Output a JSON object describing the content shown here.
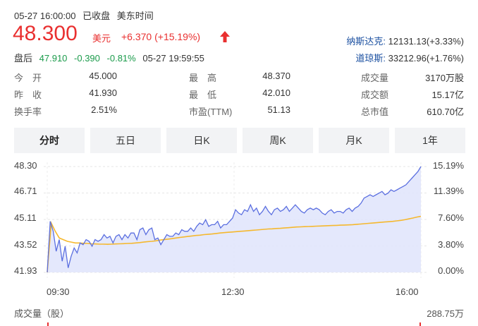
{
  "header": {
    "timestamp": "05-27 16:00:00",
    "market_status": "已收盘",
    "timezone": "美东时间"
  },
  "quote": {
    "price": "48.300",
    "currency": "美元",
    "change": "+6.370 (+15.19%)"
  },
  "after_hours": {
    "label": "盘后",
    "price": "47.910",
    "change": "-0.390",
    "pct": "-0.81%",
    "time": "05-27 19:59:55"
  },
  "indices": [
    {
      "name": "纳斯达克:",
      "value": "12131.13(+3.33%)"
    },
    {
      "name": "道琼斯:",
      "value": "33212.96(+1.76%)"
    }
  ],
  "stats": [
    [
      {
        "label": "今　开",
        "value": "45.000",
        "color": "red"
      },
      {
        "label": "最　高",
        "value": "48.370",
        "color": "red"
      },
      {
        "label": "成交量",
        "value": "3170万股",
        "color": "dark"
      }
    ],
    [
      {
        "label": "昨　收",
        "value": "41.930",
        "color": "dark"
      },
      {
        "label": "最　低",
        "value": "42.010",
        "color": "red"
      },
      {
        "label": "成交额",
        "value": "15.17亿",
        "color": "dark"
      }
    ],
    [
      {
        "label": "换手率",
        "value": "2.51%",
        "color": "dark"
      },
      {
        "label": "市盈(TTM)",
        "value": "51.13",
        "color": "dark"
      },
      {
        "label": "总市值",
        "value": "610.70亿",
        "color": "dark"
      }
    ]
  ],
  "tabs": [
    "分时",
    "五日",
    "日K",
    "周K",
    "月K",
    "1年"
  ],
  "active_tab": "分时",
  "colors": {
    "up": "#e93030",
    "down": "#1b9b4b",
    "price_line": "#5b6fe0",
    "avg_line": "#f5b82e",
    "fill": "#dfe4fb"
  },
  "chart_data": {
    "type": "line",
    "y_labels": [
      "48.30",
      "46.71",
      "45.11",
      "43.52",
      "41.93"
    ],
    "pct_labels": [
      "15.19%",
      "11.39%",
      "7.60%",
      "3.80%",
      "0.00%"
    ],
    "x_labels": [
      "09:30",
      "12:30",
      "16:00"
    ],
    "ylim": [
      41.93,
      48.3
    ],
    "series": [
      {
        "values": [
          41.93,
          45.0,
          44.4,
          43.2,
          43.9,
          42.6,
          43.5,
          42.2,
          42.9,
          43.4,
          43.1,
          43.7,
          43.6,
          43.9,
          43.8,
          43.5,
          43.9,
          43.8,
          43.9,
          44.2,
          44.0,
          44.1,
          43.7,
          44.1,
          44.2,
          43.9,
          44.2,
          44.0,
          44.3,
          44.3,
          43.9,
          44.5,
          44.6,
          44.2,
          44.5,
          44.6,
          43.9,
          44.0,
          43.6,
          43.9,
          44.2,
          44.1,
          44.1,
          44.3,
          44.2,
          44.5,
          44.4,
          44.4,
          44.6,
          44.4,
          44.7,
          44.9,
          44.8,
          45.1,
          44.7,
          44.8,
          44.8,
          45.0,
          44.6,
          44.8,
          44.8,
          45.0,
          45.2,
          45.7,
          45.5,
          45.4,
          45.7,
          45.6,
          46.0,
          45.6,
          45.8,
          45.4,
          45.6,
          45.9,
          45.6,
          45.4,
          45.7,
          45.8,
          45.6,
          45.7,
          45.9,
          45.6,
          45.8,
          46.0,
          45.8,
          45.6,
          45.5,
          45.7,
          45.8,
          45.7,
          45.8,
          45.7,
          45.5,
          45.4,
          45.6,
          45.7,
          45.5,
          45.6,
          45.6,
          45.5,
          45.7,
          45.8,
          45.6,
          45.8,
          45.9,
          46.1,
          46.4,
          46.5,
          46.6,
          46.5,
          46.6,
          46.7,
          46.8,
          46.6,
          46.7,
          46.9,
          46.8,
          46.9,
          47.0,
          47.1,
          47.2,
          47.4,
          47.6,
          47.8,
          48.0,
          48.3
        ]
      },
      {
        "values": [
          41.93,
          44.9,
          44.4,
          44.0,
          43.9,
          43.8,
          43.75,
          43.7,
          43.7,
          43.68,
          43.67,
          43.65,
          43.64,
          43.63,
          43.63,
          43.62,
          43.63,
          43.64,
          43.65,
          43.66,
          43.67,
          43.68,
          43.7,
          43.72,
          43.75,
          43.78,
          43.8,
          43.83,
          43.87,
          43.9,
          43.93,
          43.96,
          44.0,
          44.03,
          44.06,
          44.09,
          44.12,
          44.15,
          44.17,
          44.2,
          44.22,
          44.24,
          44.27,
          44.3,
          44.32,
          44.34,
          44.36,
          44.38,
          44.4,
          44.42,
          44.44,
          44.46,
          44.48,
          44.5,
          44.52,
          44.54,
          44.55,
          44.57,
          44.58,
          44.6,
          44.62,
          44.64,
          44.66,
          44.67,
          44.68,
          44.69,
          44.7,
          44.71,
          44.72,
          44.73,
          44.74,
          44.75,
          44.76,
          44.77,
          44.78,
          44.79,
          44.8,
          44.82,
          44.84,
          44.86,
          44.88,
          44.9,
          44.92,
          44.94,
          44.96,
          44.98,
          45.0,
          45.03,
          45.06,
          45.1,
          45.15,
          45.2,
          45.26,
          45.3
        ]
      }
    ]
  },
  "volume": {
    "label": "成交量（股）",
    "max": "288.75万"
  }
}
